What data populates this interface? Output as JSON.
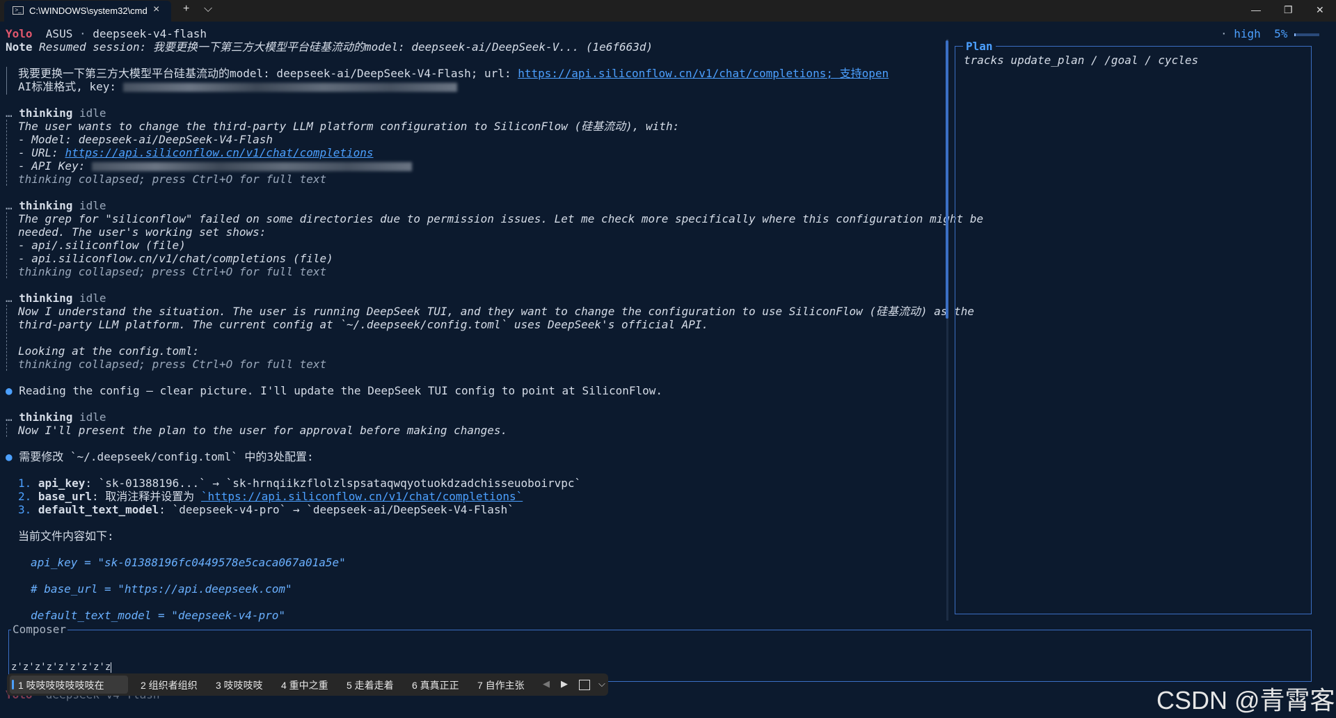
{
  "window": {
    "tab_title": "C:\\WINDOWS\\system32\\cmd",
    "new_tab": "+",
    "dropdown": "⌵",
    "close_tab": "×",
    "minimize": "—",
    "maximize": "❐",
    "close": "✕"
  },
  "header": {
    "mode": "Yolo",
    "host": "ASUS",
    "sep": "·",
    "model": "deepseek-v4-flash",
    "reasoning_dot": "·",
    "reasoning": "high",
    "progress_text": "5%",
    "progress_fraction": 0.05
  },
  "note": {
    "label": "Note",
    "text": "Resumed session: 我要更换一下第三方大模型平台硅基流动的model: deepseek-ai/DeepSeek-V... (1e6f663d)"
  },
  "user_msg": {
    "line1_prefix": "我要更换一下第三方大模型平台硅基流动的model: deepseek-ai/DeepSeek-V4-Flash; url: ",
    "line1_link": "https://api.siliconflow.cn/v1/chat/completions; 支持open",
    "line2_prefix": "AI标准格式, key: "
  },
  "thinking_1": {
    "title": "thinking",
    "state": "idle",
    "l1": "The user wants to change the third-party LLM platform configuration to SiliconFlow (硅基流动), with:",
    "l2": "- Model: deepseek-ai/DeepSeek-V4-Flash",
    "l3_prefix": "- URL: ",
    "l3_link": "https://api.siliconflow.cn/v1/chat/completions",
    "l4_prefix": "- API Key: ",
    "collapsed": "thinking collapsed; press Ctrl+O for full text"
  },
  "thinking_2": {
    "title": "thinking",
    "state": "idle",
    "l1": "The grep for \"siliconflow\" failed on some directories due to permission issues. Let me check more specifically where this configuration might be",
    "l2": "needed. The user's working set shows:",
    "l3": "- api/.siliconflow (file)",
    "l4": "- api.siliconflow.cn/v1/chat/completions (file)",
    "collapsed": "thinking collapsed; press Ctrl+O for full text"
  },
  "thinking_3": {
    "title": "thinking",
    "state": "idle",
    "l1": "Now I understand the situation. The user is running DeepSeek TUI, and they want to change the configuration to use SiliconFlow (硅基流动) as the",
    "l2": "third-party LLM platform. The current config at `~/.deepseek/config.toml` uses DeepSeek's official API.",
    "l3": "Looking at the config.toml:",
    "collapsed": "thinking collapsed; press Ctrl+O for full text"
  },
  "assistant_1": "Reading the config — clear picture. I'll update the DeepSeek TUI config to point at SiliconFlow.",
  "thinking_4": {
    "title": "thinking",
    "state": "idle",
    "l1": "Now I'll present the plan to the user for approval before making changes."
  },
  "assistant_2": {
    "intro": "需要修改 `~/.deepseek/config.toml` 中的3处配置:",
    "items": [
      {
        "num": "1.",
        "key": "api_key",
        "rest": ": `sk-01388196...` → `sk-hrnqiikzflolzlspsataqwqyotuokdzadchisseuoboirvpc`"
      },
      {
        "num": "2.",
        "key": "base_url",
        "rest": ": 取消注释并设置为 ",
        "link": "`https://api.siliconflow.cn/v1/chat/completions`"
      },
      {
        "num": "3.",
        "key": "default_text_model",
        "rest": ": `deepseek-v4-pro` → `deepseek-ai/DeepSeek-V4-Flash`"
      }
    ],
    "current_file": "当前文件内容如下:",
    "code": [
      "api_key = \"sk-01388196fc0449578e5caca067a01a5e\"",
      "# base_url = \"https://api.deepseek.com\"",
      "default_text_model = \"deepseek-v4-pro\""
    ]
  },
  "plan": {
    "title": "Plan",
    "text": "tracks update_plan / /goal / cycles"
  },
  "composer": {
    "label": "Composer",
    "input": "z'z'z'z'z'z'z'z'z"
  },
  "ime": {
    "candidates": [
      "1 吱吱吱吱吱吱吱在",
      "2 组织者组织",
      "3 吱吱吱吱",
      "4 重中之重",
      "5 走着走着",
      "6 真真正正",
      "7 自作主张"
    ],
    "prev": "◀",
    "next": "▶",
    "expand": "⌵"
  },
  "footer": {
    "mode": "Yolo",
    "model": "deepseek-v4-flash"
  },
  "watermark": "CSDN @青霄客",
  "colors": {
    "background": "#0c1a2e",
    "accent": "#4ca0ff",
    "yolo": "#e2576d"
  }
}
